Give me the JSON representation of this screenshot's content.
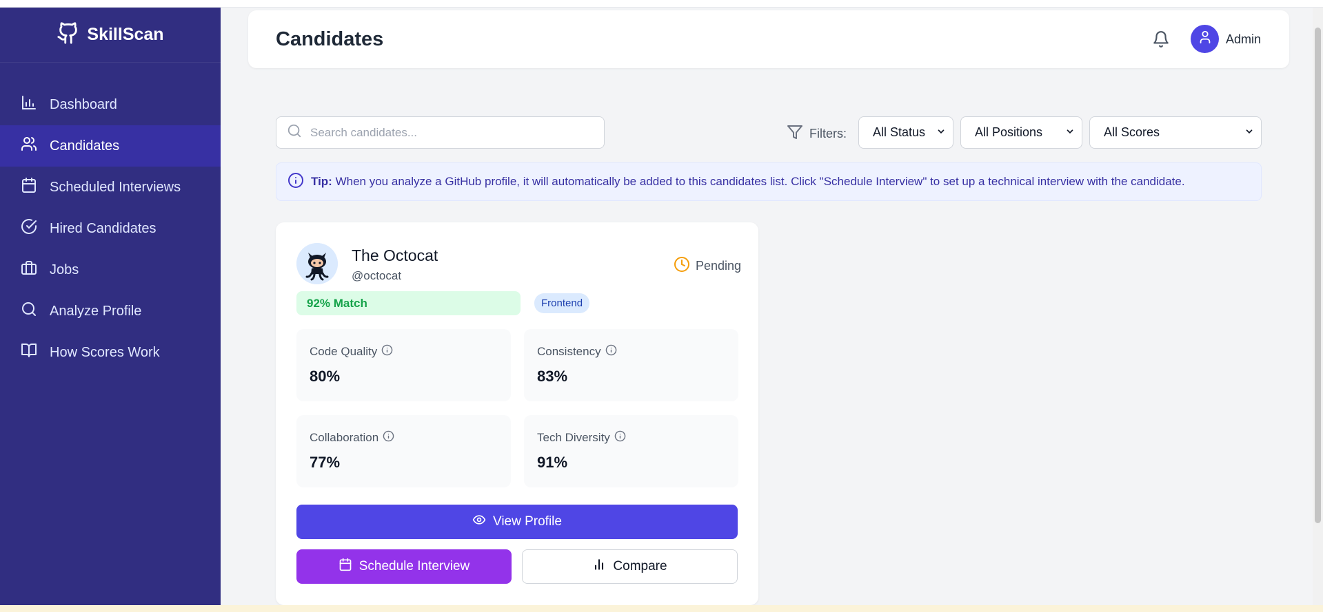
{
  "brand": {
    "name": "SkillScan"
  },
  "sidebar": {
    "items": [
      {
        "label": "Dashboard",
        "icon": "bar-chart-icon",
        "active": false
      },
      {
        "label": "Candidates",
        "icon": "users-icon",
        "active": true
      },
      {
        "label": "Scheduled Interviews",
        "icon": "calendar-icon",
        "active": false
      },
      {
        "label": "Hired Candidates",
        "icon": "check-circle-icon",
        "active": false
      },
      {
        "label": "Jobs",
        "icon": "briefcase-icon",
        "active": false
      },
      {
        "label": "Analyze Profile",
        "icon": "search-icon",
        "active": false
      },
      {
        "label": "How Scores Work",
        "icon": "book-icon",
        "active": false
      }
    ]
  },
  "header": {
    "title": "Candidates",
    "user_label": "Admin"
  },
  "toolbar": {
    "search_placeholder": "Search candidates...",
    "filters_label": "Filters:",
    "status_select": "All Status",
    "positions_select": "All Positions",
    "scores_select": "All Scores"
  },
  "tip": {
    "label": "Tip:",
    "text": "When you analyze a GitHub profile, it will automatically be added to this candidates list. Click \"Schedule Interview\" to set up a technical interview with the candidate."
  },
  "candidate": {
    "name": "The Octocat",
    "handle": "@octocat",
    "status": "Pending",
    "match": "92% Match",
    "tag": "Frontend",
    "metrics": [
      {
        "label": "Code Quality",
        "value": "80%"
      },
      {
        "label": "Consistency",
        "value": "83%"
      },
      {
        "label": "Collaboration",
        "value": "77%"
      },
      {
        "label": "Tech Diversity",
        "value": "91%"
      }
    ],
    "view_label": "View Profile",
    "schedule_label": "Schedule Interview",
    "compare_label": "Compare"
  },
  "colors": {
    "sidebar_bg": "#312e81",
    "sidebar_active": "#3730a3",
    "primary": "#4f46e5",
    "schedule": "#9333ea",
    "match_bg": "#dcfce7",
    "match_text": "#16a34a",
    "pending": "#f59e0b"
  }
}
